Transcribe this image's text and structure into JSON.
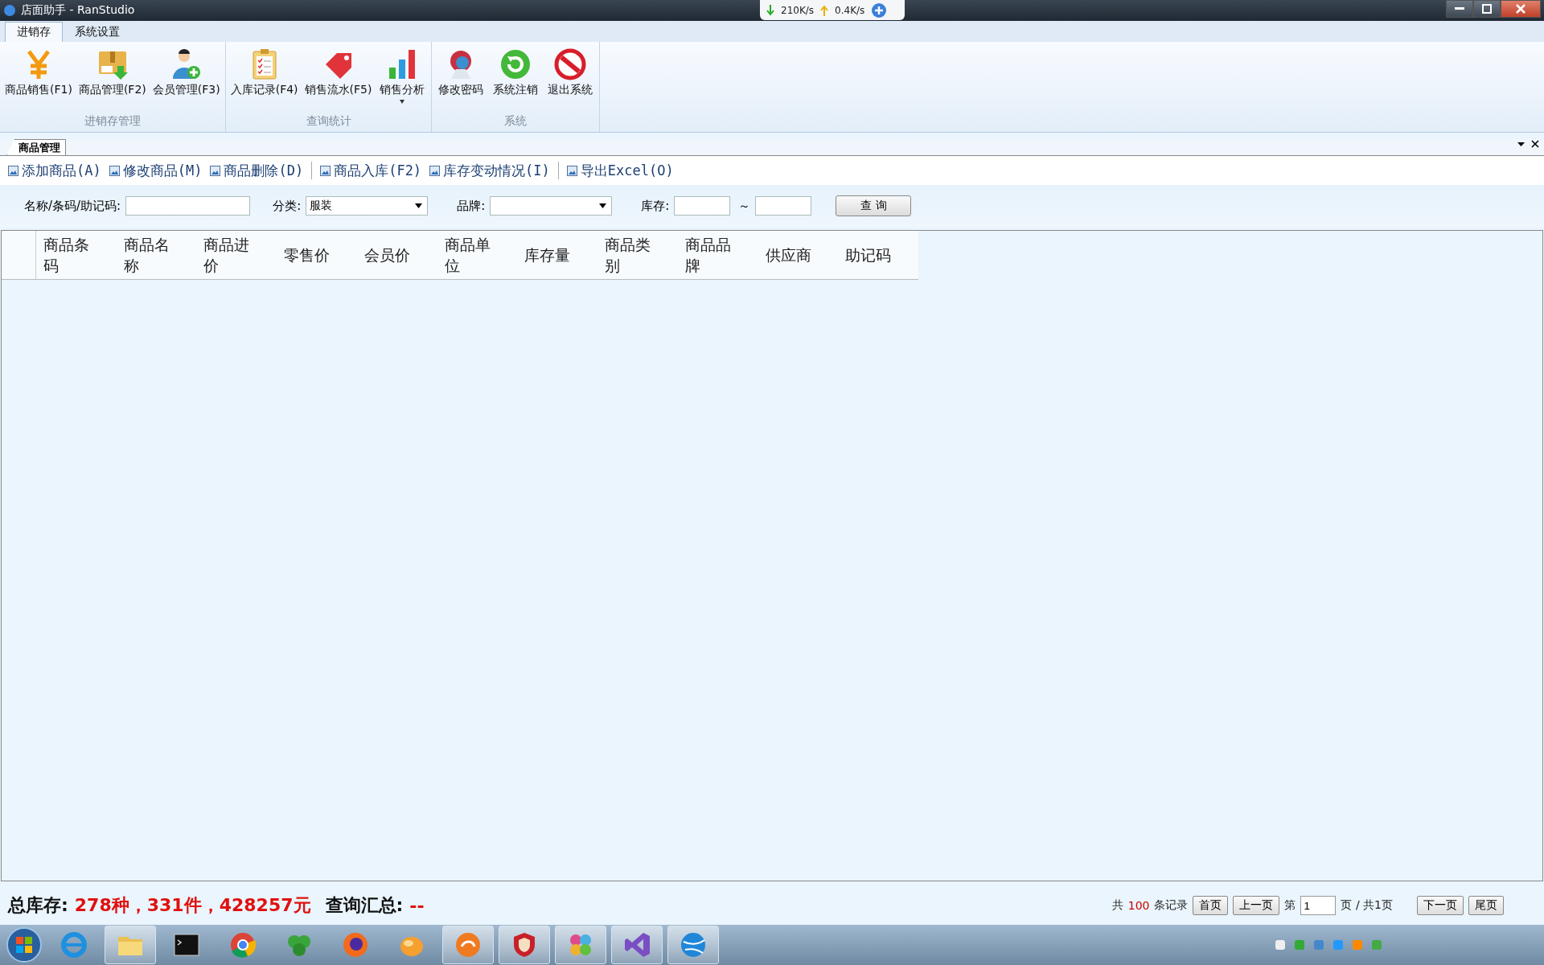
{
  "window": {
    "title": "店面助手 - RanStudio"
  },
  "net_monitor": {
    "download": "210K/s",
    "upload": "0.4K/s"
  },
  "menu_tabs": [
    {
      "label": "进销存",
      "selected": true
    },
    {
      "label": "系统设置",
      "selected": false
    }
  ],
  "ribbon_groups": [
    {
      "title": "进销存管理",
      "buttons": [
        {
          "label": "商品销售(F1)",
          "kind": "yen",
          "dropdown": false
        },
        {
          "label": "商品管理(F2)",
          "kind": "box",
          "dropdown": false
        },
        {
          "label": "会员管理(F3)",
          "kind": "user",
          "dropdown": false
        }
      ]
    },
    {
      "title": "查询统计",
      "buttons": [
        {
          "label": "入库记录(F4)",
          "kind": "clipboard",
          "dropdown": false
        },
        {
          "label": "销售流水(F5)",
          "kind": "tag",
          "dropdown": false
        },
        {
          "label": "销售分析",
          "kind": "chart",
          "dropdown": true
        }
      ]
    },
    {
      "title": "系统",
      "buttons": [
        {
          "label": "修改密码",
          "kind": "key",
          "dropdown": false
        },
        {
          "label": "系统注销",
          "kind": "refresh",
          "dropdown": false
        },
        {
          "label": "退出系统",
          "kind": "stop",
          "dropdown": false
        }
      ]
    }
  ],
  "document_tab": {
    "label": "商品管理"
  },
  "toolbar": [
    {
      "label": "添加商品(A)",
      "separator_before": false
    },
    {
      "label": "修改商品(M)",
      "separator_before": false
    },
    {
      "label": "商品删除(D)",
      "separator_before": false
    },
    {
      "label": "商品入库(F2)",
      "separator_before": true
    },
    {
      "label": "库存变动情况(I)",
      "separator_before": false
    },
    {
      "label": "导出Excel(O)",
      "separator_before": true
    }
  ],
  "search": {
    "name_label": "名称/条码/助记码:",
    "category_label": "分类:",
    "category_value": "服装",
    "brand_label": "品牌:",
    "stock_label": "库存:",
    "range_sep": "～",
    "query_button": "查 询"
  },
  "table": {
    "columns": [
      "商品条码",
      "商品名称",
      "商品进价",
      "零售价",
      "会员价",
      "商品单位",
      "库存量",
      "商品类别",
      "商品品牌",
      "供应商",
      "助记码"
    ]
  },
  "summary": {
    "label": "总库存:",
    "value": "278种，331件，428257元",
    "query_label": "查询汇总:",
    "query_value": "--"
  },
  "pager": {
    "total_prefix": "共",
    "total": "100",
    "total_suffix": "条记录",
    "first": "首页",
    "prev": "上一页",
    "page_prefix": "第",
    "page": "1",
    "page_suffix": "页 / 共1页",
    "next": "下一页",
    "last": "尾页"
  },
  "taskbar": {
    "apps": [
      {
        "kind": "ie",
        "selected": false
      },
      {
        "kind": "folder",
        "selected": true
      },
      {
        "kind": "terminal",
        "selected": false
      },
      {
        "kind": "chrome",
        "selected": false
      },
      {
        "kind": "leaf",
        "selected": false
      },
      {
        "kind": "firefox",
        "selected": false
      },
      {
        "kind": "orange",
        "selected": false
      },
      {
        "kind": "swirl",
        "selected": true
      },
      {
        "kind": "shield",
        "selected": true
      },
      {
        "kind": "puzzle",
        "selected": true
      },
      {
        "kind": "vs",
        "selected": true
      },
      {
        "kind": "globe",
        "selected": true
      }
    ]
  }
}
